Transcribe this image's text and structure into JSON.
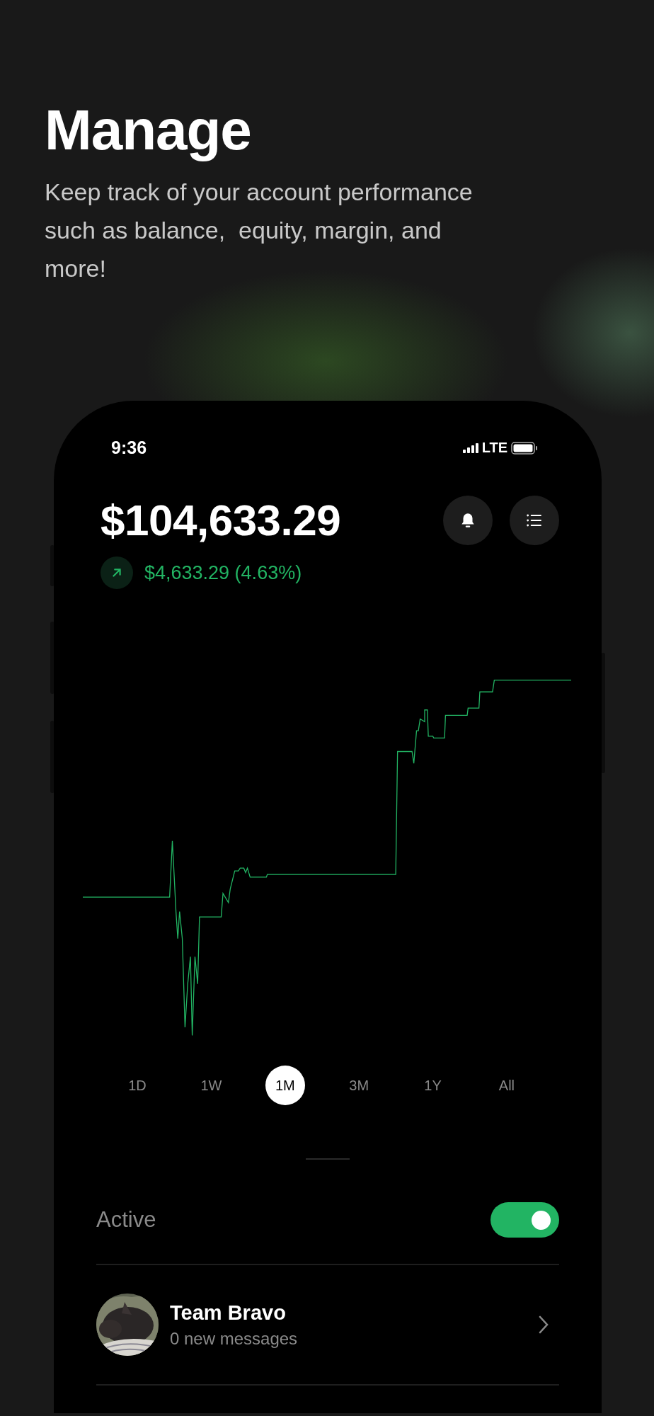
{
  "header": {
    "title": "Manage",
    "subtitle": "Keep track of your account performance such as balance,  equity, margin, and more!"
  },
  "phone": {
    "status_bar": {
      "time": "9:36",
      "network": "LTE"
    },
    "balance": "$104,633.29",
    "change": {
      "text": "$4,633.29 (4.63%)",
      "rising": true
    },
    "ranges": [
      {
        "label": "1D",
        "selected": false
      },
      {
        "label": "1W",
        "selected": false
      },
      {
        "label": "1M",
        "selected": true
      },
      {
        "label": "3M",
        "selected": false
      },
      {
        "label": "1Y",
        "selected": false
      },
      {
        "label": "All",
        "selected": false
      }
    ],
    "active": {
      "label": "Active",
      "on": true
    },
    "chats": [
      {
        "name": "Team Bravo",
        "subtitle": "0 new messages"
      }
    ]
  }
}
